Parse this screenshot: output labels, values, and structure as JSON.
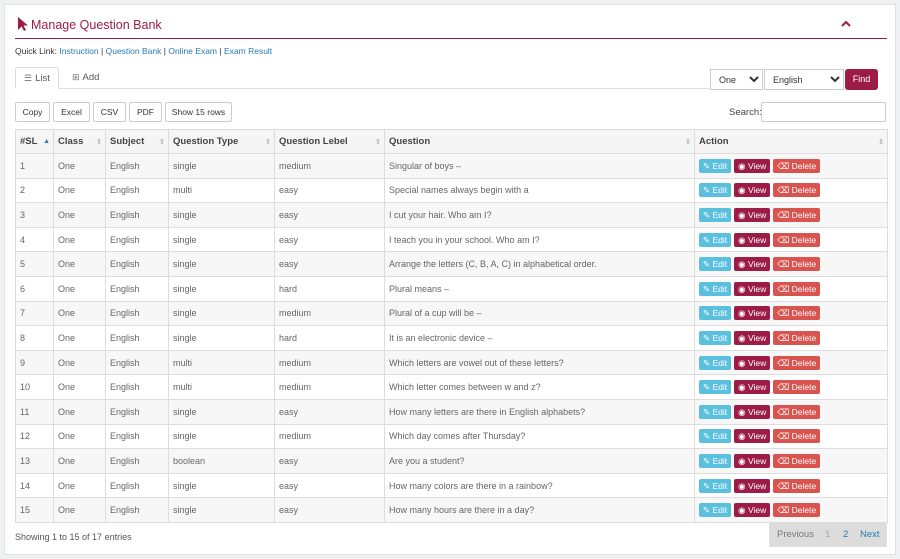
{
  "header": {
    "title": "Manage Question Bank"
  },
  "quick_links": {
    "label": "Quick Link:",
    "items": [
      "Instruction",
      "Question Bank",
      "Online Exam",
      "Exam Result"
    ],
    "separator": "|"
  },
  "tabs": {
    "list": "List",
    "add": "Add"
  },
  "filters": {
    "class_value": "One",
    "language_value": "English",
    "find_label": "Find"
  },
  "toolbar": {
    "copy": "Copy",
    "excel": "Excel",
    "csv": "CSV",
    "pdf": "PDF",
    "show_rows": "Show 15 rows"
  },
  "search": {
    "label": "Search:"
  },
  "table": {
    "columns": [
      "#SL",
      "Class",
      "Subject",
      "Question Type",
      "Question Lebel",
      "Question",
      "Action"
    ],
    "actions": {
      "edit": "Edit",
      "view": "View",
      "delete": "Delete"
    },
    "rows": [
      [
        "1",
        "One",
        "English",
        "single",
        "medium",
        "Singular of boys –"
      ],
      [
        "2",
        "One",
        "English",
        "multi",
        "easy",
        "Special names always begin with a"
      ],
      [
        "3",
        "One",
        "English",
        "single",
        "easy",
        "I cut your hair. Who am I?"
      ],
      [
        "4",
        "One",
        "English",
        "single",
        "easy",
        "I teach you in your school. Who am I?"
      ],
      [
        "5",
        "One",
        "English",
        "single",
        "easy",
        "Arrange the letters (C, B, A, C) in alphabetical order."
      ],
      [
        "6",
        "One",
        "English",
        "single",
        "hard",
        "Plural means –"
      ],
      [
        "7",
        "One",
        "English",
        "single",
        "medium",
        "Plural of a cup will be –"
      ],
      [
        "8",
        "One",
        "English",
        "single",
        "hard",
        "It is an electronic device –"
      ],
      [
        "9",
        "One",
        "English",
        "multi",
        "medium",
        "Which letters are vowel out of these letters?"
      ],
      [
        "10",
        "One",
        "English",
        "multi",
        "medium",
        "Which letter comes between w and z?"
      ],
      [
        "11",
        "One",
        "English",
        "single",
        "easy",
        "How many letters are there in English alphabets?"
      ],
      [
        "12",
        "One",
        "English",
        "single",
        "medium",
        "Which day comes after Thursday?"
      ],
      [
        "13",
        "One",
        "English",
        "boolean",
        "easy",
        "Are you a student?"
      ],
      [
        "14",
        "One",
        "English",
        "single",
        "easy",
        "How many colors are there in a rainbow?"
      ],
      [
        "15",
        "One",
        "English",
        "single",
        "easy",
        "How many hours are there in a day?"
      ]
    ]
  },
  "footer": {
    "info": "Showing 1 to 15 of 17 entries",
    "previous": "Previous",
    "page1": "1",
    "page2": "2",
    "next": "Next"
  },
  "colors": {
    "brand": "#9c1c47",
    "edit": "#5bc0de",
    "delete": "#d9534f",
    "link": "#2a7ab0"
  }
}
